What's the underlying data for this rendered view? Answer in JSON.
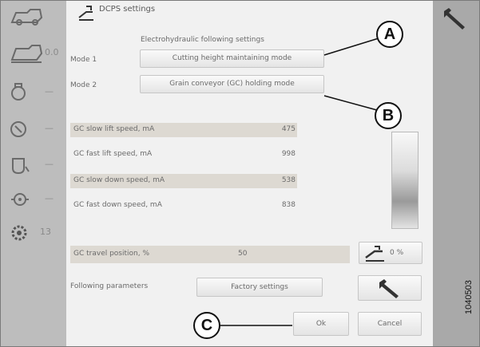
{
  "header": {
    "title": "DCPS settings"
  },
  "sidebar": {
    "items": [
      {
        "icon": "harvester-icon",
        "value": ""
      },
      {
        "icon": "header-height-icon",
        "value": "0.0"
      },
      {
        "icon": "fuel-icon",
        "value": "—"
      },
      {
        "icon": "temperature-icon",
        "value": "—"
      },
      {
        "icon": "oil-pressure-icon",
        "value": "—"
      },
      {
        "icon": "fan-speed-icon",
        "value": "—"
      },
      {
        "icon": "engine-gear-icon",
        "value": "13"
      }
    ]
  },
  "main": {
    "subtitle": "Electrohydraulic following settings",
    "mode1": {
      "label": "Mode 1",
      "value": "Cutting height maintaining mode"
    },
    "mode2": {
      "label": "Mode 2",
      "value": "Grain conveyor (GC) holding mode"
    },
    "parameters": [
      {
        "label": "GC slow lift speed, mA",
        "value": "475"
      },
      {
        "label": "GC fast lift speed, mA",
        "value": "998"
      },
      {
        "label": "GC slow down speed, mA",
        "value": "538"
      },
      {
        "label": "GC fast down speed, mA",
        "value": "838"
      }
    ],
    "travel_position": {
      "label": "GC travel position, %",
      "value": "50",
      "indicator": "0 %"
    },
    "following": {
      "label": "Following parameters",
      "button": "Factory settings"
    },
    "ok_button": "Ok",
    "cancel_button": "Cancel"
  },
  "callouts": {
    "a": "A",
    "b": "B",
    "c": "C"
  },
  "figure_number": "1040503"
}
